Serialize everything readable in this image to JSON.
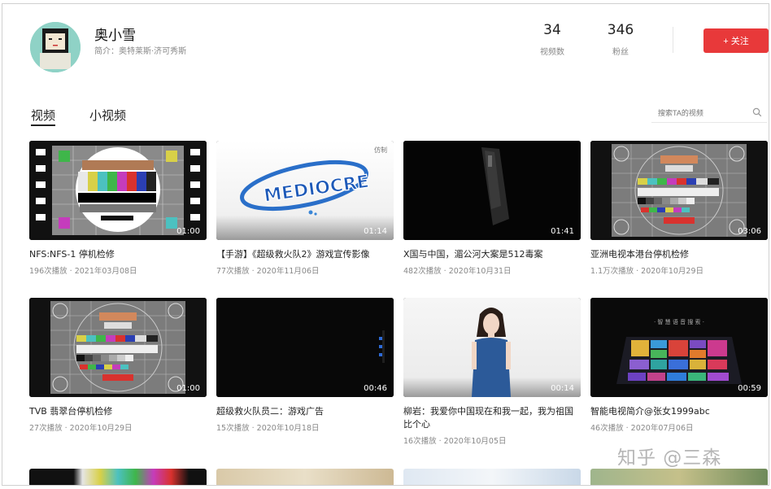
{
  "profile": {
    "name": "奥小雪",
    "bio": "简介：奥特莱斯·济可秀斯",
    "stats": [
      {
        "value": "34",
        "label": "视频数"
      },
      {
        "value": "346",
        "label": "粉丝"
      }
    ],
    "follow_label": "+ 关注"
  },
  "tabs": [
    {
      "label": "视频",
      "active": true
    },
    {
      "label": "小视频",
      "active": false
    }
  ],
  "search": {
    "placeholder": "搜索TA的视频"
  },
  "videos": [
    {
      "title": "NFS:NFS-1 停机检修",
      "views": "196次播放",
      "date": "2021年03月08日",
      "duration": "01:00"
    },
    {
      "title": "【手游】《超级救火队2》游戏宣传影像",
      "views": "77次播放",
      "date": "2020年11月06日",
      "duration": "01:14",
      "corner_badge": "仿制"
    },
    {
      "title": "X国与中国，湄公河大案是512毒案",
      "views": "482次播放",
      "date": "2020年10月31日",
      "duration": "01:41"
    },
    {
      "title": "亚洲电视本港台停机检修",
      "views": "1.1万次播放",
      "date": "2020年10月29日",
      "duration": "03:06"
    },
    {
      "title": "TVB 翡翠台停机检修",
      "views": "27次播放",
      "date": "2020年10月29日",
      "duration": "01:00"
    },
    {
      "title": "超级救火队员二：游戏广告",
      "views": "15次播放",
      "date": "2020年10月18日",
      "duration": "00:46"
    },
    {
      "title": "柳岩：我爱你中国现在和我一起，我为祖国比个心",
      "views": "16次播放",
      "date": "2020年10月05日",
      "duration": "00:14"
    },
    {
      "title": "智能电视简介@张女1999abc",
      "views": "46次播放",
      "date": "2020年07月06日",
      "duration": "00:59",
      "screen_text": "· 智 慧 语 音 搜 索 ·"
    }
  ],
  "thumb_labels": {
    "mediocre_logo": "MEDIOCRE"
  },
  "watermark": "知乎 @三森",
  "colors": {
    "accent": "#e8393a",
    "text": "#222222",
    "muted": "#888888"
  }
}
